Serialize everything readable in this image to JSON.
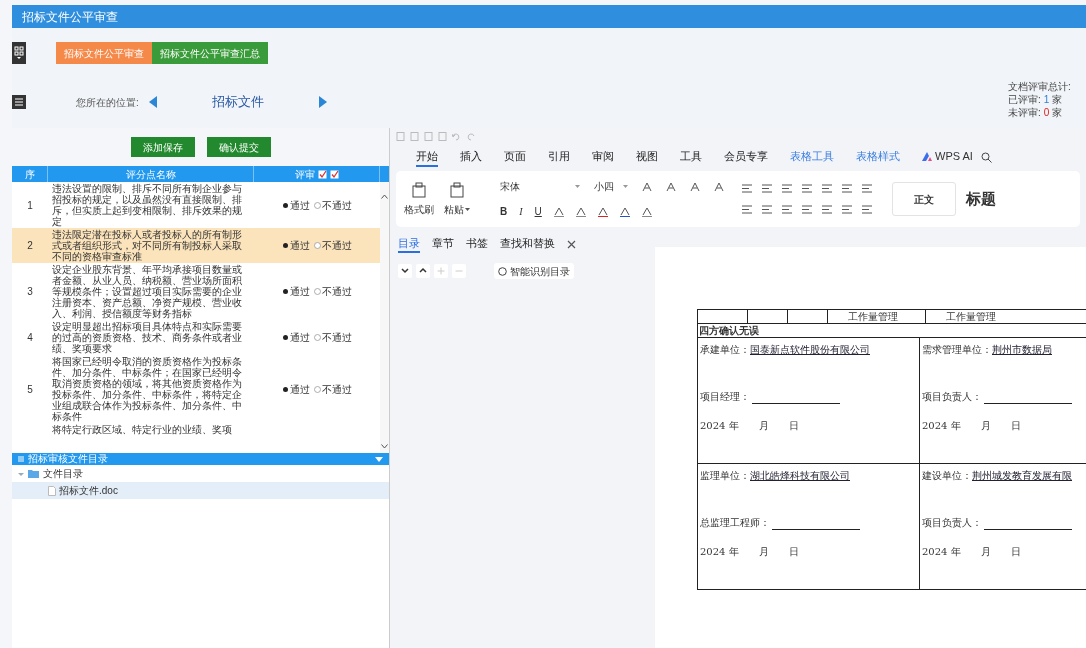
{
  "window": {
    "title": "招标文件公平审查"
  },
  "module_tabs": [
    {
      "label": "招标文件公平审查",
      "selected": true
    },
    {
      "label": "招标文件公平审查汇总",
      "selected": false
    }
  ],
  "location": {
    "label": "您所在的位置:",
    "current": "招标文件"
  },
  "stats": {
    "total_label": "文档评审总计:",
    "reviewed_label": "已评审:",
    "reviewed_count": "1",
    "reviewed_unit": "家",
    "pending_label": "未评审:",
    "pending_count": "0",
    "pending_unit": "家"
  },
  "actions": [
    "添加保存",
    "确认提交"
  ],
  "review_table": {
    "columns": [
      "序",
      "评分点名称",
      "评审"
    ],
    "rows": [
      {
        "no": "1",
        "text": "违法设置的限制、排斥不同所有制企业参与招投标的规定，以及虽然没有直接限制、排斥，但实质上起到变相限制、排斥效果的规定",
        "highlighted": false,
        "options": [
          {
            "label": "通过",
            "selected": true
          },
          {
            "label": "不通过",
            "selected": false
          }
        ]
      },
      {
        "no": "2",
        "text": "违法限定潜在投标人或者投标人的所有制形式或者组织形式，对不同所有制投标人采取不同的资格审查标准",
        "highlighted": true,
        "options": [
          {
            "label": "通过",
            "selected": true
          },
          {
            "label": "不通过",
            "selected": false
          }
        ]
      },
      {
        "no": "3",
        "text": "设定企业股东背景、年平均承接项目数量或者金额、从业人员、纳税额、营业场所面积等规模条件；设置超过项目实际需要的企业注册资本、资产总额、净资产规模、营业收入、利润、授信额度等财务指标",
        "highlighted": false,
        "options": [
          {
            "label": "通过",
            "selected": true
          },
          {
            "label": "不通过",
            "selected": false
          }
        ]
      },
      {
        "no": "4",
        "text": "设定明显超出招标项目具体特点和实际需要的过高的资质资格、技术、商务条件或者业绩、奖项要求",
        "highlighted": false,
        "options": [
          {
            "label": "通过",
            "selected": true
          },
          {
            "label": "不通过",
            "selected": false
          }
        ]
      },
      {
        "no": "5",
        "text": "将国家已经明令取消的资质资格作为投标条件、加分条件、中标条件；在国家已经明令取消资质资格的领域，将其他资质资格作为投标条件、加分条件、中标条件，将特定企业组成联合体作为投标条件、加分条件、中标条件",
        "highlighted": false,
        "options": [
          {
            "label": "通过",
            "selected": true
          },
          {
            "label": "不通过",
            "selected": false
          }
        ]
      },
      {
        "no": "",
        "text": "将特定行政区域、特定行业的业绩、奖项",
        "highlighted": false,
        "options": []
      }
    ]
  },
  "file_tree": {
    "title": "招标审核文件目录",
    "items": [
      {
        "label": "文件目录",
        "expanded": true,
        "children": [
          {
            "label": "招标文件.doc",
            "selected": true
          }
        ]
      }
    ]
  },
  "editor": {
    "tabs": [
      {
        "label": "开始",
        "kind": "normal",
        "selected": true
      },
      {
        "label": "插入",
        "kind": "normal",
        "selected": false
      },
      {
        "label": "页面",
        "kind": "normal",
        "selected": false
      },
      {
        "label": "引用",
        "kind": "normal",
        "selected": false
      },
      {
        "label": "审阅",
        "kind": "normal",
        "selected": false
      },
      {
        "label": "视图",
        "kind": "normal",
        "selected": false
      },
      {
        "label": "工具",
        "kind": "normal",
        "selected": false
      },
      {
        "label": "会员专享",
        "kind": "normal",
        "selected": false
      },
      {
        "label": "表格工具",
        "kind": "context",
        "selected": false
      },
      {
        "label": "表格样式",
        "kind": "context",
        "selected": false
      },
      {
        "label": "WPS AI",
        "kind": "ai",
        "selected": false
      }
    ],
    "ribbon": {
      "format_painter": "格式刷",
      "paste": "粘贴",
      "font": "宋体",
      "size": "小四",
      "bold": "B",
      "italic": "I",
      "underline": "U",
      "styles": [
        "正文",
        "标题"
      ]
    },
    "nav_tabs": [
      {
        "label": "目录",
        "selected": true
      },
      {
        "label": "章节",
        "selected": false
      },
      {
        "label": "书签",
        "selected": false
      },
      {
        "label": "查找和替换",
        "selected": false
      }
    ],
    "smart_toc": "智能识别目录",
    "document": {
      "header_cells": [
        "工作量管理",
        "工作量管理"
      ],
      "caption": "四方确认无误",
      "parties": [
        {
          "label": "承建单位：",
          "value": "国泰新点软件股份有限公司",
          "sign_label": "项目经理：",
          "date": [
            "2024 年",
            "月",
            "日"
          ]
        },
        {
          "label": "需求管理单位：",
          "value": "荆州市数据局",
          "sign_label": "项目负责人：",
          "date": [
            "2024 年",
            "月",
            "日"
          ]
        },
        {
          "label": "监理单位：",
          "value": "湖北皓烽科技有限公司",
          "sign_label": "总监理工程师：",
          "date": [
            "2024 年",
            "月",
            "日"
          ]
        },
        {
          "label": "建设单位：",
          "value": "荆州城发教育发展有限",
          "sign_label": "项目负责人：",
          "date": [
            "2024 年",
            "月",
            "日"
          ]
        }
      ]
    }
  }
}
